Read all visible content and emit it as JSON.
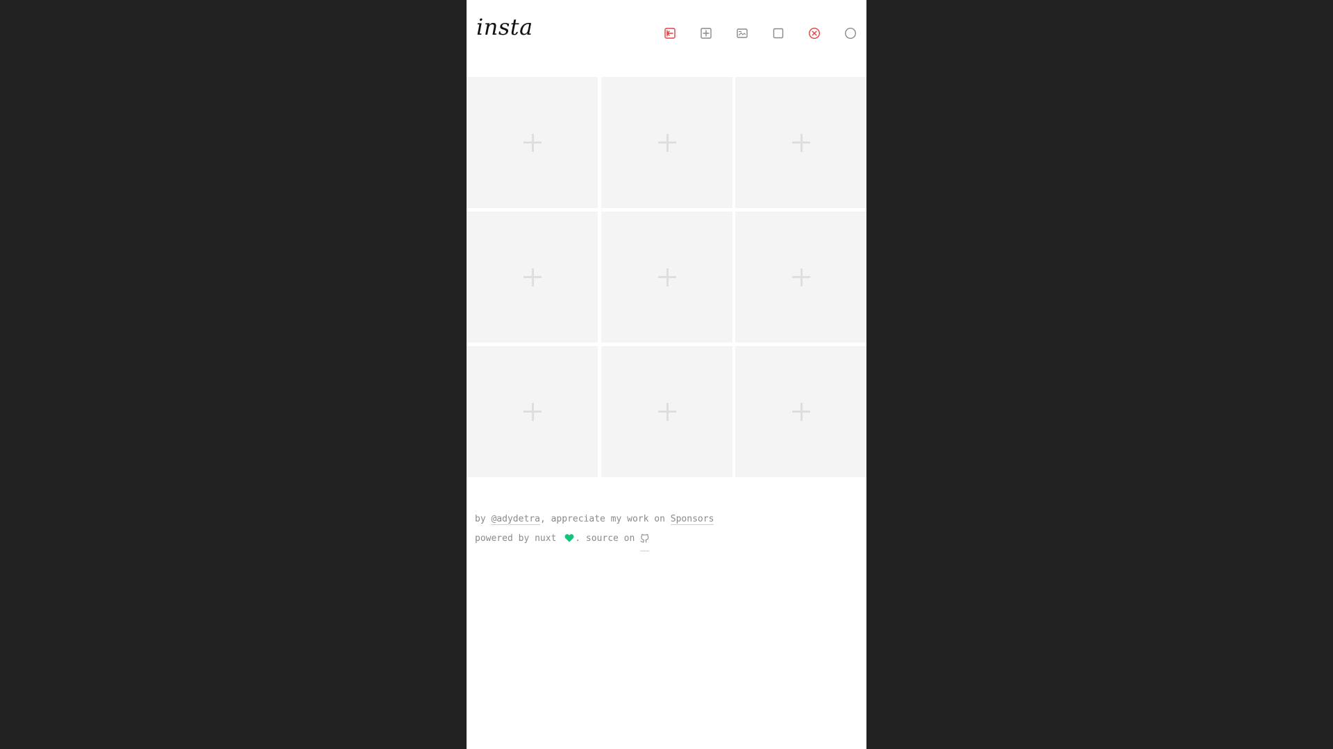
{
  "header": {
    "logo": "insta",
    "tools": [
      {
        "name": "back-icon",
        "color": "#e53e3e"
      },
      {
        "name": "grid-add-icon",
        "color": "#888888"
      },
      {
        "name": "image-icon",
        "color": "#888888"
      },
      {
        "name": "square-icon",
        "color": "#888888"
      },
      {
        "name": "close-circle-icon",
        "color": "#e53e3e"
      },
      {
        "name": "circle-icon",
        "color": "#888888"
      }
    ]
  },
  "grid": {
    "cells": [
      {
        "id": 1,
        "icon": "plus-icon"
      },
      {
        "id": 2,
        "icon": "plus-icon"
      },
      {
        "id": 3,
        "icon": "plus-icon"
      },
      {
        "id": 4,
        "icon": "plus-icon"
      },
      {
        "id": 5,
        "icon": "plus-icon"
      },
      {
        "id": 6,
        "icon": "plus-icon"
      },
      {
        "id": 7,
        "icon": "plus-icon"
      },
      {
        "id": 8,
        "icon": "plus-icon"
      },
      {
        "id": 9,
        "icon": "plus-icon"
      }
    ]
  },
  "footer": {
    "line1_prefix": "by ",
    "author_link": "@adydetra",
    "line1_middle": ", appreciate my work on ",
    "sponsors_link": "Sponsors",
    "line2_prefix": "powered by nuxt ",
    "line2_middle": ". source on ",
    "heart_color": "#10c47a",
    "source_icon": "github-icon"
  },
  "colors": {
    "page_background": "#222222",
    "app_background": "#ffffff",
    "cell_background": "#f4f4f4",
    "accent_red": "#e53e3e"
  }
}
